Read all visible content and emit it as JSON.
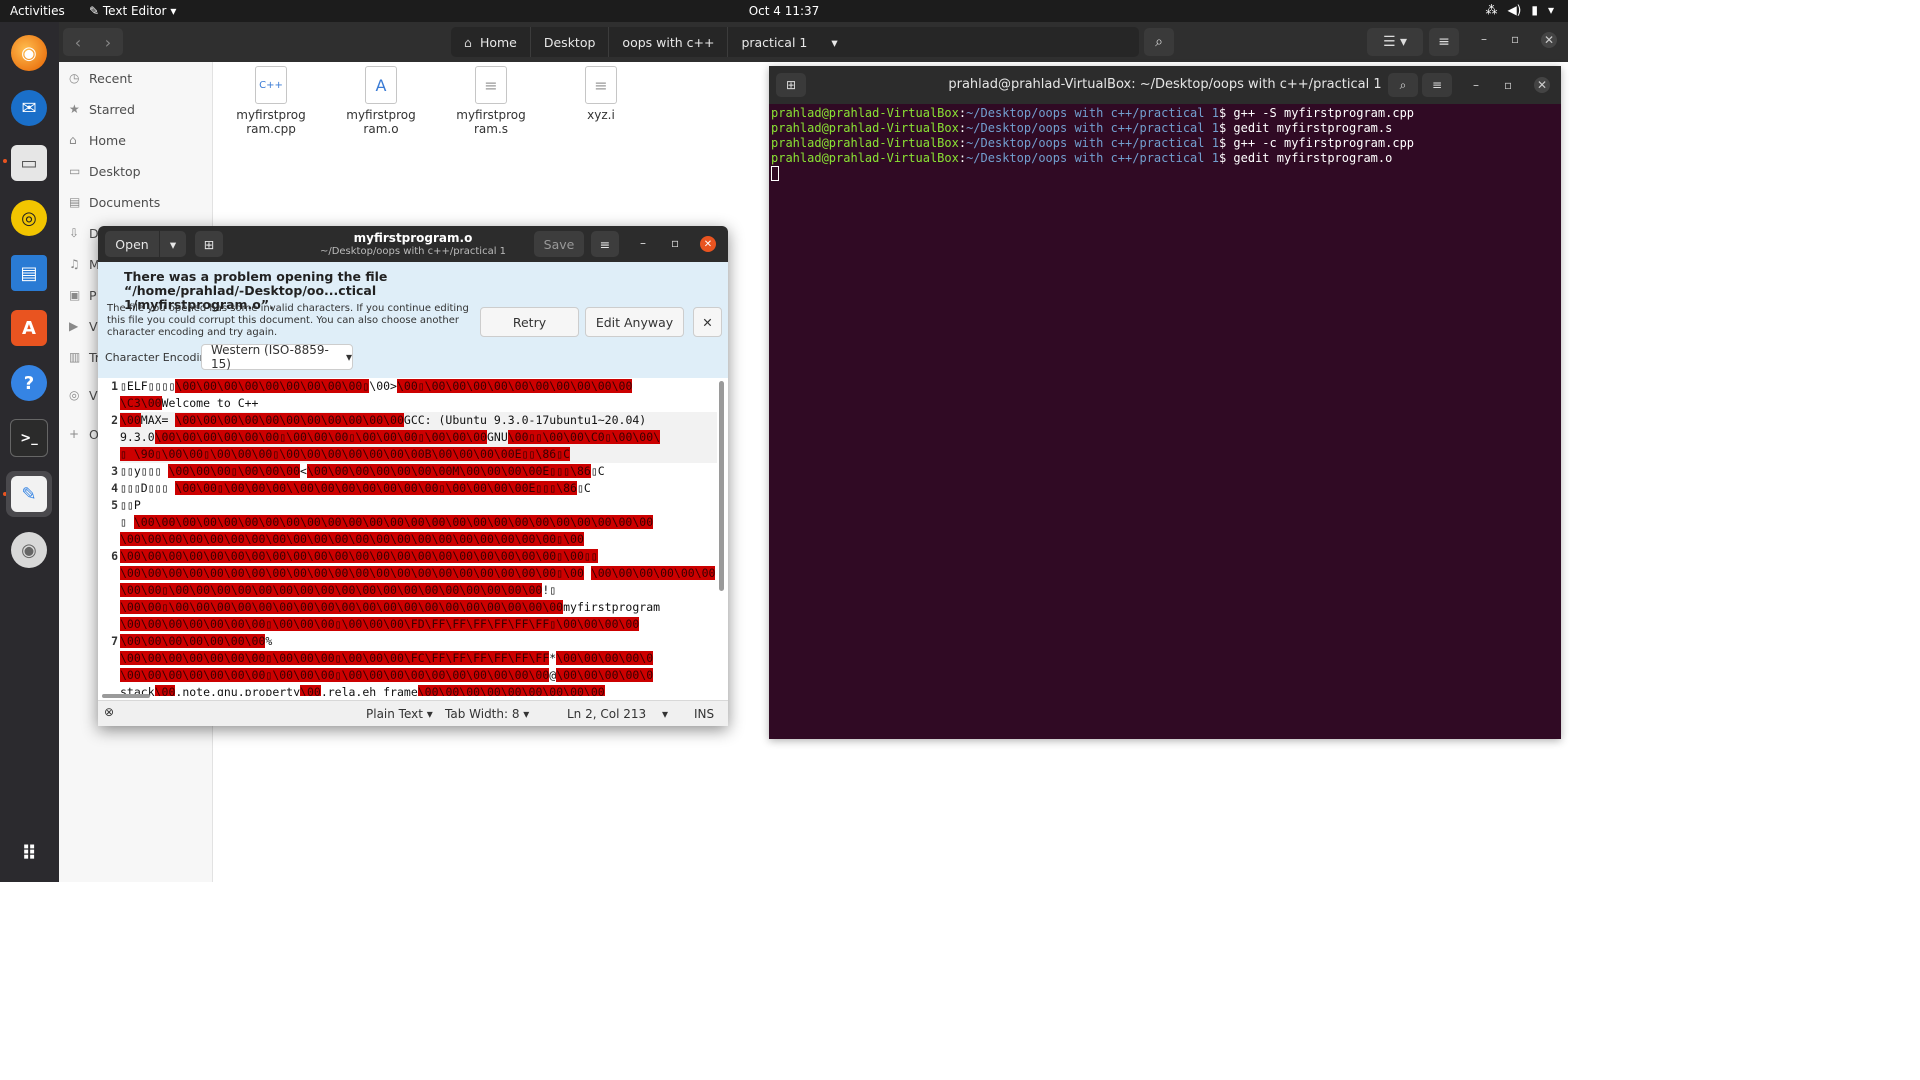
{
  "topbar": {
    "activities": "Activities",
    "app_name": "Text Editor",
    "clock": "Oct 4  11:37",
    "tray_icons": [
      "network-icon",
      "volume-icon",
      "battery-icon",
      "power-menu-icon"
    ]
  },
  "dock": {
    "apps": [
      "firefox",
      "thunderbird",
      "files",
      "rhythmbox",
      "libreoffice-writer",
      "ubuntu-software",
      "help",
      "terminal",
      "text-editor",
      "dvd-drive",
      "show-applications"
    ]
  },
  "file_manager": {
    "breadcrumbs": [
      "Home",
      "Desktop",
      "oops with c++",
      "practical 1"
    ],
    "sidebar": [
      "Recent",
      "Starred",
      "Home",
      "Desktop",
      "Documents",
      "Downloads",
      "Music",
      "Pictures",
      "Videos",
      "Trash",
      "VBox",
      "Other Locations"
    ],
    "sidebar_visible": [
      "Recent",
      "Starred",
      "Home",
      "Desktop",
      "Documents",
      "D",
      "M",
      "P",
      "V",
      "Tr",
      "V",
      "O"
    ],
    "files": [
      {
        "name_line1": "myfirstprog",
        "name_line2": "ram.cpp",
        "icon_text": "C++"
      },
      {
        "name_line1": "myfirstprog",
        "name_line2": "ram.o",
        "icon_text": "A"
      },
      {
        "name_line1": "myfirstprog",
        "name_line2": "ram.s",
        "icon_text": "≡"
      },
      {
        "name_line1": "xyz.i",
        "name_line2": "",
        "icon_text": "≡"
      }
    ]
  },
  "terminal": {
    "title": "prahlad@prahlad-VirtualBox: ~/Desktop/oops with c++/practical 1",
    "lines": [
      {
        "user": "prahlad@prahlad-VirtualBox",
        "path": "~/Desktop/oops with c++/practical 1",
        "cmd": "$ g++ -S myfirstprogram.cpp"
      },
      {
        "user": "prahlad@prahlad-VirtualBox",
        "path": "~/Desktop/oops with c++/practical 1",
        "cmd": "$ gedit myfirstprogram.s"
      },
      {
        "user": "prahlad@prahlad-VirtualBox",
        "path": "~/Desktop/oops with c++/practical 1",
        "cmd": "$ g++ -c myfirstprogram.cpp"
      },
      {
        "user": "prahlad@prahlad-VirtualBox",
        "path": "~/Desktop/oops with c++/practical 1",
        "cmd": "$ gedit myfirstprogram.o"
      }
    ]
  },
  "gedit": {
    "open_label": "Open",
    "save_label": "Save",
    "title": "myfirstprogram.o",
    "subtitle": "~/Desktop/oops with c++/practical 1",
    "info": {
      "title": "There was a problem opening the file “/home/prahlad/-Desktop/oo...ctical 1/myfirstprogram.o”.",
      "message": "The file you opened has some invalid characters. If you continue editing this file you could corrupt this document. You can also choose another character encoding and try again.",
      "retry": "Retry",
      "edit_anyway": "Edit Anyway",
      "encoding_label": "Character Encoding:",
      "encoding_value": "Western (ISO-8859-15)"
    },
    "line_numbers": [
      "1",
      "2",
      "3",
      "4",
      "5",
      "6",
      "7"
    ],
    "code_rows": [
      {
        "gutter": "1",
        "hl": false,
        "segs": [
          {
            "t": "▯ELF▯▯▯▯",
            "r": false
          },
          {
            "t": "\\00\\00\\00\\00\\00\\00\\00\\00\\00▯",
            "r": true
          },
          {
            "t": "\\00>",
            "r": false
          },
          {
            "t": "\\00▯",
            "r": true
          },
          {
            "t": "\\00\\00\\00\\00\\00\\00\\00\\00\\00\\00",
            "r": true
          }
        ]
      },
      {
        "gutter": "",
        "hl": false,
        "segs": [
          {
            "t": "\\C3\\00",
            "r": true
          },
          {
            "t": "Welcome to C++",
            "r": false
          }
        ]
      },
      {
        "gutter": "2",
        "hl": true,
        "segs": [
          {
            "t": "\\00",
            "r": true
          },
          {
            "t": "MAX= ",
            "r": false
          },
          {
            "t": "\\00\\00\\00\\00\\00\\00\\00\\00\\00\\00\\00",
            "r": true
          },
          {
            "t": "GCC: (Ubuntu 9.3.0-17ubuntu1~20.04)",
            "r": false
          }
        ]
      },
      {
        "gutter": "",
        "hl": true,
        "segs": [
          {
            "t": "9.3.0",
            "r": false
          },
          {
            "t": "\\00\\00\\00\\00\\00\\00▯\\00\\00\\00▯\\00\\00\\00▯\\00\\00\\00",
            "r": true
          },
          {
            "t": "GNU",
            "r": false
          },
          {
            "t": "\\00▯▯\\00\\00\\C0▯\\00\\00\\",
            "r": true
          }
        ]
      },
      {
        "gutter": "",
        "hl": true,
        "segs": [
          {
            "t": "▯ \\90▯\\00\\00▯\\00\\00\\00▯\\00\\00\\00\\00\\00\\00\\00B\\00\\00\\00\\00E▯▯\\86▯C",
            "r": true
          }
        ]
      },
      {
        "gutter": "3",
        "hl": false,
        "segs": [
          {
            "t": "▯▯y▯▯▯ ",
            "r": false
          },
          {
            "t": "\\00\\00\\00▯\\00\\00\\00",
            "r": true
          },
          {
            "t": "<",
            "r": false
          },
          {
            "t": "\\00\\00\\00\\00\\00\\00\\00M\\00\\00\\00\\00E▯▯▯\\86",
            "r": true
          },
          {
            "t": "▯C",
            "r": false
          }
        ]
      },
      {
        "gutter": "4",
        "hl": false,
        "segs": [
          {
            "t": "▯▯▯D▯▯▯ ",
            "r": false
          },
          {
            "t": "\\00\\00▯\\00\\00\\00\\",
            "r": true
          },
          {
            "t": "\\00\\00\\00\\00\\00\\00\\00▯\\00\\00\\00\\00E▯▯▯\\86",
            "r": true
          },
          {
            "t": "▯C",
            "r": false
          }
        ]
      },
      {
        "gutter": "5",
        "hl": false,
        "segs": [
          {
            "t": "▯▯P",
            "r": false
          }
        ]
      },
      {
        "gutter": "",
        "hl": false,
        "segs": [
          {
            "t": "▯ ",
            "r": false
          },
          {
            "t": "\\00\\00\\00\\00\\00\\00\\00\\00\\00\\00\\00\\00\\00\\00\\00\\00\\00\\00\\00\\00\\00\\00\\00\\00\\00",
            "r": true
          }
        ]
      },
      {
        "gutter": "",
        "hl": false,
        "segs": [
          {
            "t": "\\00\\00\\00\\00\\00\\00\\00\\00\\00\\00\\00\\00\\00\\00\\00\\00\\00\\00\\00\\00\\00▯\\00",
            "r": true
          }
        ]
      },
      {
        "gutter": "6",
        "hl": false,
        "segs": [
          {
            "t": "\\00\\00\\00\\00\\00\\00\\00\\00\\00\\00\\00\\00\\00\\00\\00\\00\\00\\00\\00\\00\\00▯\\00▯▯",
            "r": true
          }
        ]
      },
      {
        "gutter": "",
        "hl": false,
        "segs": [
          {
            "t": "\\00\\00\\00\\00\\00\\00\\00\\00\\00\\00\\00\\00\\00\\00\\00\\00\\00\\00\\00\\00\\00▯\\00",
            "r": true
          },
          {
            "t": " ",
            "r": false
          },
          {
            "t": "\\00\\00\\00\\00\\00\\00",
            "r": true
          }
        ]
      },
      {
        "gutter": "",
        "hl": false,
        "segs": [
          {
            "t": "\\00\\00▯\\00\\00\\00\\00\\00\\00\\00\\00\\00\\00\\00\\00\\00\\00\\00\\00\\00\\00",
            "r": true
          },
          {
            "t": "!▯",
            "r": false
          }
        ]
      },
      {
        "gutter": "",
        "hl": false,
        "segs": [
          {
            "t": "\\00\\00▯\\00\\00\\00\\00\\00\\00\\00\\00\\00\\00\\00\\00\\00\\00\\00\\00\\00\\00\\00",
            "r": true
          },
          {
            "t": "myfirstprogram",
            "r": false
          }
        ]
      },
      {
        "gutter": "",
        "hl": false,
        "segs": [
          {
            "t": "\\00\\00\\00\\00\\00\\00\\00▯\\00\\00\\00▯\\00\\00\\00\\FD\\FF\\FF\\FF\\FF\\FF\\FF▯\\00\\00\\00\\00",
            "r": true
          }
        ]
      },
      {
        "gutter": "7",
        "hl": false,
        "segs": [
          {
            "t": "\\00\\00\\00\\00\\00\\00\\00",
            "r": true
          },
          {
            "t": "%",
            "r": false
          }
        ]
      },
      {
        "gutter": "",
        "hl": false,
        "segs": [
          {
            "t": "\\00\\00\\00\\00\\00\\00\\00▯\\00\\00\\00▯\\00\\00\\00\\FC\\FF\\FF\\FF\\FF\\FF\\FF",
            "r": true
          },
          {
            "t": "*",
            "r": false
          },
          {
            "t": "\\00\\00\\00\\00\\0",
            "r": true
          }
        ]
      },
      {
        "gutter": "",
        "hl": false,
        "segs": [
          {
            "t": "\\00\\00\\00\\00\\00\\00\\00▯\\00\\00\\00▯\\00\\00\\00\\00\\00\\00\\00\\00\\00\\00",
            "r": true
          },
          {
            "t": "@",
            "r": false
          },
          {
            "t": "\\00\\00\\00\\00\\0",
            "r": true
          }
        ]
      },
      {
        "gutter": "",
        "hl": false,
        "segs": [
          {
            "t": "stack",
            "r": false
          },
          {
            "t": "\\00",
            "r": true
          },
          {
            "t": ".note.gnu.property",
            "r": false
          },
          {
            "t": "\\00",
            "r": true
          },
          {
            "t": ".rela.eh_frame",
            "r": false
          },
          {
            "t": "\\00\\00\\00\\00\\00\\00\\00\\00\\00",
            "r": true
          }
        ]
      }
    ],
    "status": {
      "language": "Plain Text",
      "tab_width": "Tab Width: 8",
      "position": "Ln 2, Col 213",
      "mode": "INS"
    }
  },
  "colors": {
    "terminal_bg": "#300a24",
    "prompt_user": "#8ae234",
    "prompt_path": "#729fcf",
    "invalid_char_bg": "#cc0000",
    "ubuntu_orange": "#e95420"
  }
}
